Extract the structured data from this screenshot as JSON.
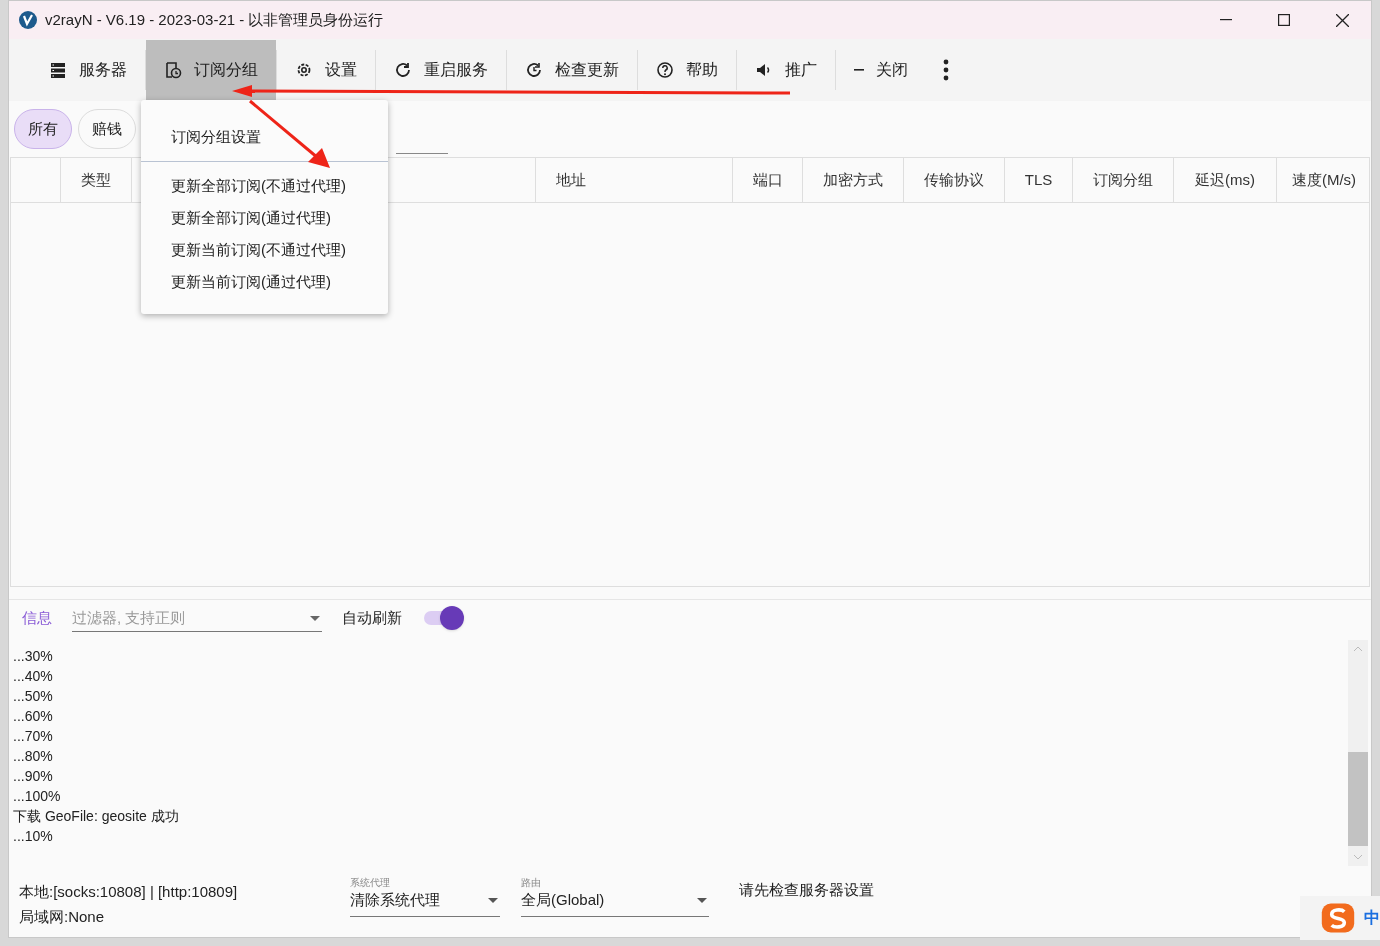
{
  "window": {
    "title": "v2rayN - V6.19 - 2023-03-21 - 以非管理员身份运行"
  },
  "toolbar": [
    {
      "label": "服务器",
      "selected": false
    },
    {
      "label": "订阅分组",
      "selected": true
    },
    {
      "label": "设置",
      "selected": false
    },
    {
      "label": "重启服务",
      "selected": false
    },
    {
      "label": "检查更新",
      "selected": false
    },
    {
      "label": "帮助",
      "selected": false
    },
    {
      "label": "推广",
      "selected": false
    },
    {
      "label": "关闭",
      "selected": false
    }
  ],
  "filter_tabs": [
    {
      "label": "所有",
      "selected": true
    },
    {
      "label": "赔钱",
      "selected": false
    }
  ],
  "table": {
    "columns": [
      {
        "label": "类型"
      },
      {
        "label": "地址"
      },
      {
        "label": "端口"
      },
      {
        "label": "加密方式"
      },
      {
        "label": "传输协议"
      },
      {
        "label": "TLS"
      },
      {
        "label": "订阅分组"
      },
      {
        "label": "延迟(ms)"
      },
      {
        "label": "速度(M/s)"
      }
    ]
  },
  "menu": {
    "sections": [
      [
        "订阅分组设置"
      ],
      [
        "更新全部订阅(不通过代理)",
        "更新全部订阅(通过代理)",
        "更新当前订阅(不通过代理)",
        "更新当前订阅(通过代理)"
      ]
    ]
  },
  "log": {
    "tab": "信息",
    "filter_placeholder": "过滤器, 支持正则",
    "auto_refresh": {
      "label": "自动刷新",
      "on": true
    },
    "lines": [
      "...30%",
      "...40%",
      "...50%",
      "...60%",
      "...70%",
      "...80%",
      "...90%",
      "...100%",
      "下载 GeoFile: geosite 成功",
      "...10%"
    ]
  },
  "status_bar": {
    "local": "本地:[socks:10808] | [http:10809]",
    "lan": "局域网:None",
    "system_proxy": {
      "label": "系统代理",
      "value": "清除系统代理"
    },
    "routing": {
      "label": "路由",
      "value": "全局(Global)"
    },
    "message": "请先检查服务器设置"
  },
  "ime": {
    "label": "中"
  }
}
